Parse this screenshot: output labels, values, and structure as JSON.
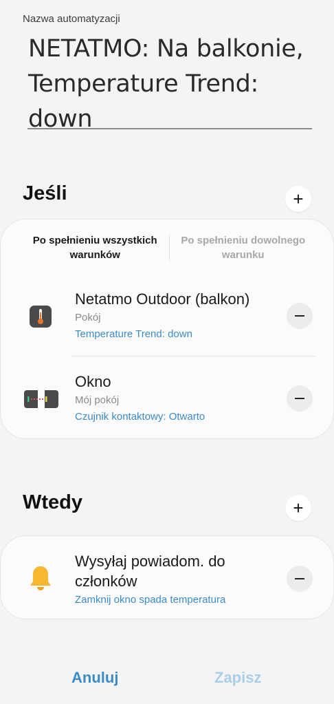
{
  "automation": {
    "name_label": "Nazwa automatyzacji",
    "name_value": "NETATMO: Na balkonie, Temperature Trend: down"
  },
  "if_section": {
    "title": "Jeśli",
    "add_icon": "plus-icon",
    "tabs": [
      {
        "label": "Po spełnieniu wszystkich warunków",
        "active": true
      },
      {
        "label": "Po spełnieniu dowolnego warunku",
        "active": false
      }
    ],
    "conditions": [
      {
        "icon": "thermometer-device-icon",
        "title": "Netatmo Outdoor (balkon)",
        "room": "Pokój",
        "detail": "Temperature Trend: down"
      },
      {
        "icon": "contact-sensor-icon",
        "title": "Okno",
        "room": "Mój pokój",
        "detail": "Czujnik kontaktowy: Otwarto"
      }
    ]
  },
  "then_section": {
    "title": "Wtedy",
    "add_icon": "plus-icon",
    "actions": [
      {
        "icon": "bell-icon",
        "title": "Wysyłaj powiadom. do członków",
        "detail": "Zamknij okno spada temperatura"
      }
    ]
  },
  "footer": {
    "cancel_label": "Anuluj",
    "save_label": "Zapisz"
  },
  "colors": {
    "accent": "#3a8bc8",
    "accent_disabled": "#a9cfe8",
    "bell": "#f7b731"
  }
}
